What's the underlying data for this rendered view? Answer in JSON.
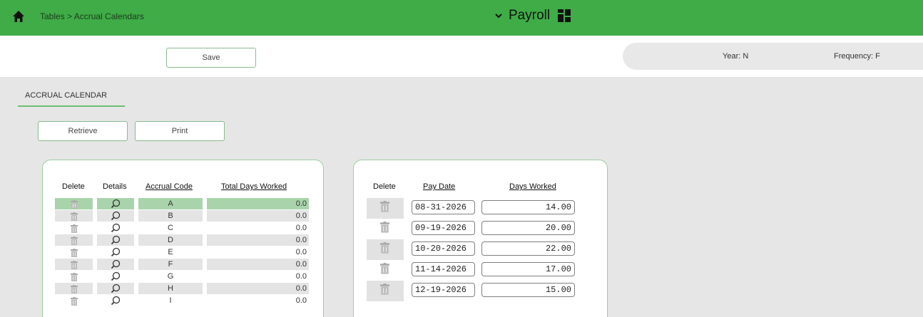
{
  "header": {
    "breadcrumb": "Tables > Accrual Calendars",
    "app_title": "Payroll",
    "home_icon": "home-icon",
    "chevron_icon": "chevron-down-icon",
    "grid_icon": "dashboard-grid-icon",
    "bar_color": "#3fac47"
  },
  "toolbar": {
    "save_label": "Save",
    "year_text": "Year: N",
    "frequency_text": "Frequency: F"
  },
  "section": {
    "tab_label": "ACCRUAL CALENDAR",
    "retrieve_label": "Retrieve",
    "print_label": "Print"
  },
  "left_table": {
    "headers": {
      "delete": "Delete",
      "details": "Details",
      "accrual_code": "Accrual Code",
      "total_days_worked": "Total Days Worked"
    },
    "selected_row": 0,
    "rows": [
      {
        "code": "A",
        "total": "0.0"
      },
      {
        "code": "B",
        "total": "0.0"
      },
      {
        "code": "C",
        "total": "0.0"
      },
      {
        "code": "D",
        "total": "0.0"
      },
      {
        "code": "E",
        "total": "0.0"
      },
      {
        "code": "F",
        "total": "0.0"
      },
      {
        "code": "G",
        "total": "0.0"
      },
      {
        "code": "H",
        "total": "0.0"
      },
      {
        "code": "I",
        "total": "0.0"
      }
    ]
  },
  "right_table": {
    "headers": {
      "delete": "Delete",
      "pay_date": "Pay Date",
      "days_worked": "Days Worked"
    },
    "rows": [
      {
        "pay_date": "08-31-2026",
        "days_worked": "14.00"
      },
      {
        "pay_date": "09-19-2026",
        "days_worked": "20.00"
      },
      {
        "pay_date": "10-20-2026",
        "days_worked": "22.00"
      },
      {
        "pay_date": "11-14-2026",
        "days_worked": "17.00"
      },
      {
        "pay_date": "12-19-2026",
        "days_worked": "15.00"
      }
    ]
  }
}
